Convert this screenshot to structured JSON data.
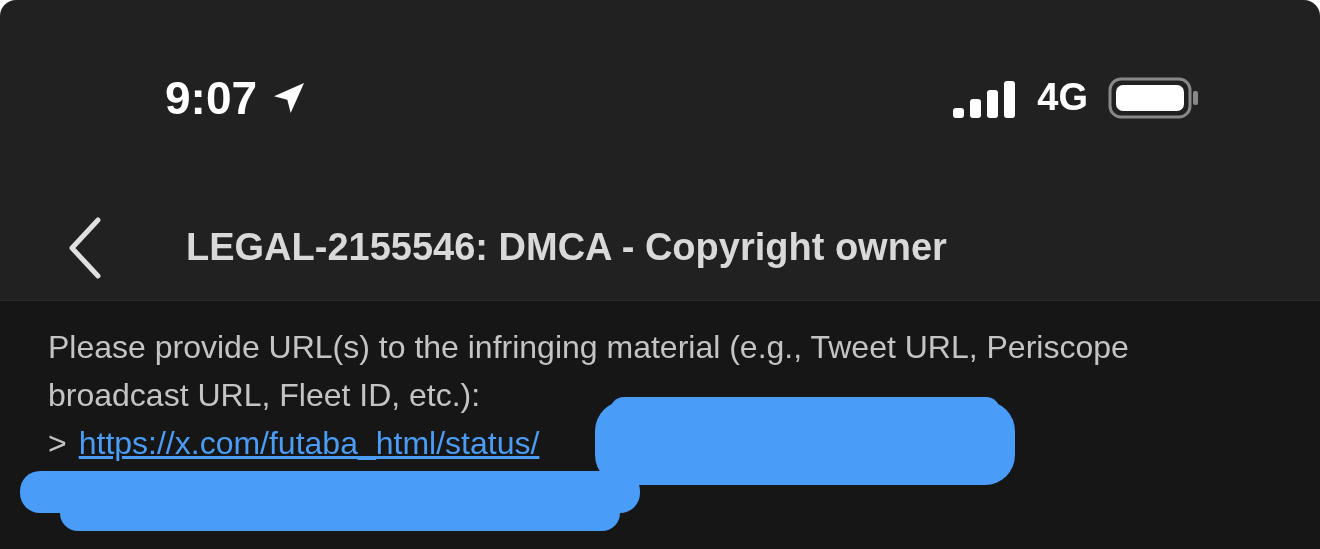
{
  "status_bar": {
    "time": "9:07",
    "network": "4G"
  },
  "nav": {
    "title": "LEGAL-2155546: DMCA - Copyright owner"
  },
  "message": {
    "text": "Please provide URL(s) to the infringing material (e.g., Tweet URL, Periscope broadcast URL, Fleet ID, etc.):",
    "quote_marker": ">",
    "link": "https://x.com/futaba_html/status/"
  }
}
